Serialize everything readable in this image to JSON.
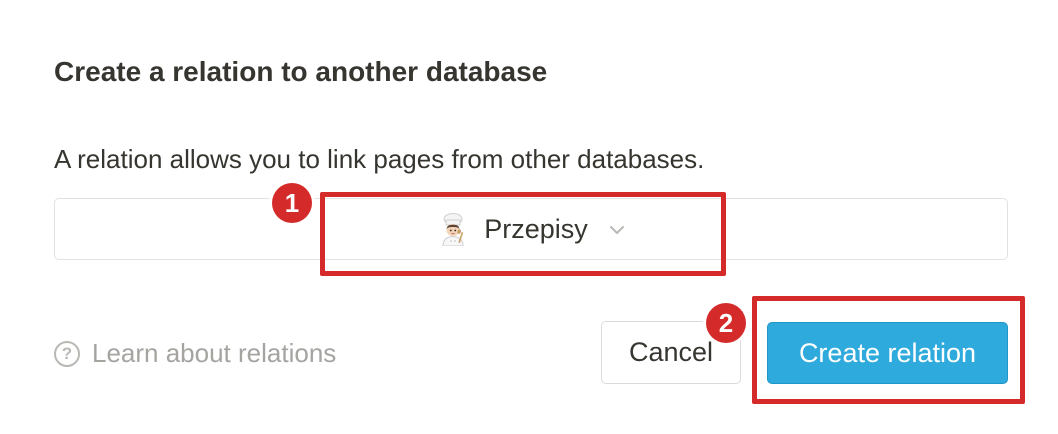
{
  "dialog": {
    "title": "Create a relation to another database",
    "description": "A relation allows you to link pages from other databases."
  },
  "database_select": {
    "icon": "chef-emoji-icon",
    "selected": "Przepisy"
  },
  "footer": {
    "learn_link": "Learn about relations",
    "cancel_label": "Cancel",
    "create_label": "Create relation"
  },
  "annotations": {
    "badge_1": "1",
    "badge_2": "2"
  },
  "colors": {
    "accent": "#2eaadc",
    "annotation": "#d42a2a",
    "text": "#37352f",
    "muted": "#a5a4a1"
  }
}
